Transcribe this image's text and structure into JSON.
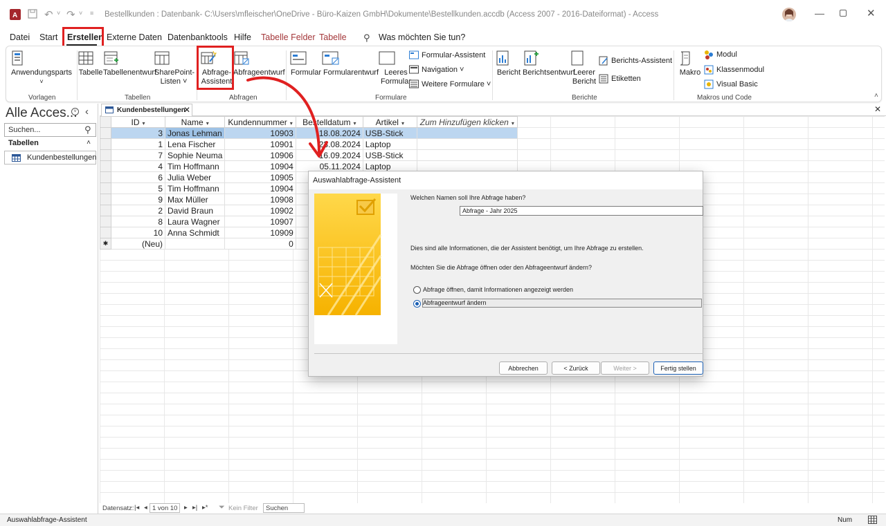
{
  "window": {
    "title": "Bestellkunden : Datenbank- C:\\Users\\mfleischer\\OneDrive - Büro-Kaizen GmbH\\Dokumente\\Bestellkunden.accdb (Access 2007 - 2016-Dateiformat)  -  Access"
  },
  "menu": {
    "items": [
      "Datei",
      "Start",
      "Erstellen",
      "Externe Daten",
      "Datenbanktools",
      "Hilfe",
      "Tabelle Felder",
      "Tabelle"
    ],
    "search_placeholder": "Was möchten Sie tun?"
  },
  "ribbon": {
    "vorlagen": {
      "label": "Vorlagen",
      "anwendungsparts": "Anwendungsparts"
    },
    "tabellen": {
      "label": "Tabellen",
      "tabelle": "Tabelle",
      "tabellenentwurf": "Tabellenentwurf",
      "sharepoint_1": "SharePoint-",
      "sharepoint_2": "Listen ˅"
    },
    "abfragen": {
      "label": "Abfragen",
      "assistent_1": "Abfrage-",
      "assistent_2": "Assistent",
      "entwurf": "Abfrageentwurf"
    },
    "formulare": {
      "label": "Formulare",
      "formular": "Formular",
      "formularentwurf": "Formularentwurf",
      "leeres_1": "Leeres",
      "leeres_2": "Formular",
      "assistent": "Formular-Assistent",
      "navigation": "Navigation ˅",
      "weitere": "Weitere Formulare ˅"
    },
    "berichte": {
      "label": "Berichte",
      "bericht": "Bericht",
      "berichtsentwurf": "Berichtsentwurf",
      "leerer_1": "Leerer",
      "leerer_2": "Bericht",
      "assistent": "Berichts-Assistent",
      "etiketten": "Etiketten"
    },
    "makros": {
      "label": "Makros und Code",
      "makro": "Makro",
      "modul": "Modul",
      "klassenmodul": "Klassenmodul",
      "visual_basic": "Visual Basic"
    }
  },
  "nav": {
    "header": "Alle Acces...",
    "search_placeholder": "Suchen...",
    "group": "Tabellen",
    "object": "Kundenbestellungen"
  },
  "doc_tab": {
    "label": "Kundenbestellungen"
  },
  "table": {
    "columns": [
      "ID",
      "Name",
      "Kundennummer",
      "Bestelldatum",
      "Artikel",
      "Zum Hinzufügen klicken"
    ],
    "rows": [
      [
        "3",
        "Jonas Lehman",
        "10903",
        "18.08.2024",
        "USB-Stick"
      ],
      [
        "1",
        "Lena Fischer",
        "10901",
        "23.08.2024",
        "Laptop"
      ],
      [
        "7",
        "Sophie Neuma",
        "10906",
        "16.09.2024",
        "USB-Stick"
      ],
      [
        "4",
        "Tim Hoffmann",
        "10904",
        "05.11.2024",
        "Laptop"
      ],
      [
        "6",
        "Julia Weber",
        "10905",
        "",
        ""
      ],
      [
        "5",
        "Tim Hoffmann",
        "10904",
        "",
        ""
      ],
      [
        "9",
        "Max Müller",
        "10908",
        "",
        ""
      ],
      [
        "2",
        "David Braun",
        "10902",
        "",
        ""
      ],
      [
        "8",
        "Laura Wagner",
        "10907",
        "",
        ""
      ],
      [
        "10",
        "Anna Schmidt",
        "10909",
        "",
        ""
      ]
    ],
    "new_row": {
      "id": "(Neu)",
      "kundennummer": "0"
    }
  },
  "record_nav": {
    "label": "Datensatz:",
    "position": "1 von 10",
    "filter": "Kein Filter",
    "search": "Suchen"
  },
  "status": {
    "left": "Auswahlabfrage-Assistent",
    "right": "Num"
  },
  "wizard": {
    "title": "Auswahlabfrage-Assistent",
    "q_name": "Welchen Namen soll Ihre Abfrage haben?",
    "name_value": "Abfrage - Jahr 2025",
    "info": "Dies sind alle Informationen, die der Assistent benötigt, um Ihre Abfrage zu erstellen.",
    "q_open": "Möchten Sie die Abfrage öffnen oder den Abfrageentwurf ändern?",
    "opt_open": "Abfrage öffnen, damit Informationen angezeigt werden",
    "opt_design": "Abfrageentwurf ändern",
    "selected_option": "opt_design",
    "btn_cancel": "Abbrechen",
    "btn_back": "< Zurück",
    "btn_next": "Weiter >",
    "btn_finish": "Fertig stellen"
  },
  "colors": {
    "accent": "#1a5fb4",
    "annotation": "#e02020",
    "context_tab": "#a4373a",
    "access_red": "#a4262c",
    "selection": "#bcd6f0"
  }
}
